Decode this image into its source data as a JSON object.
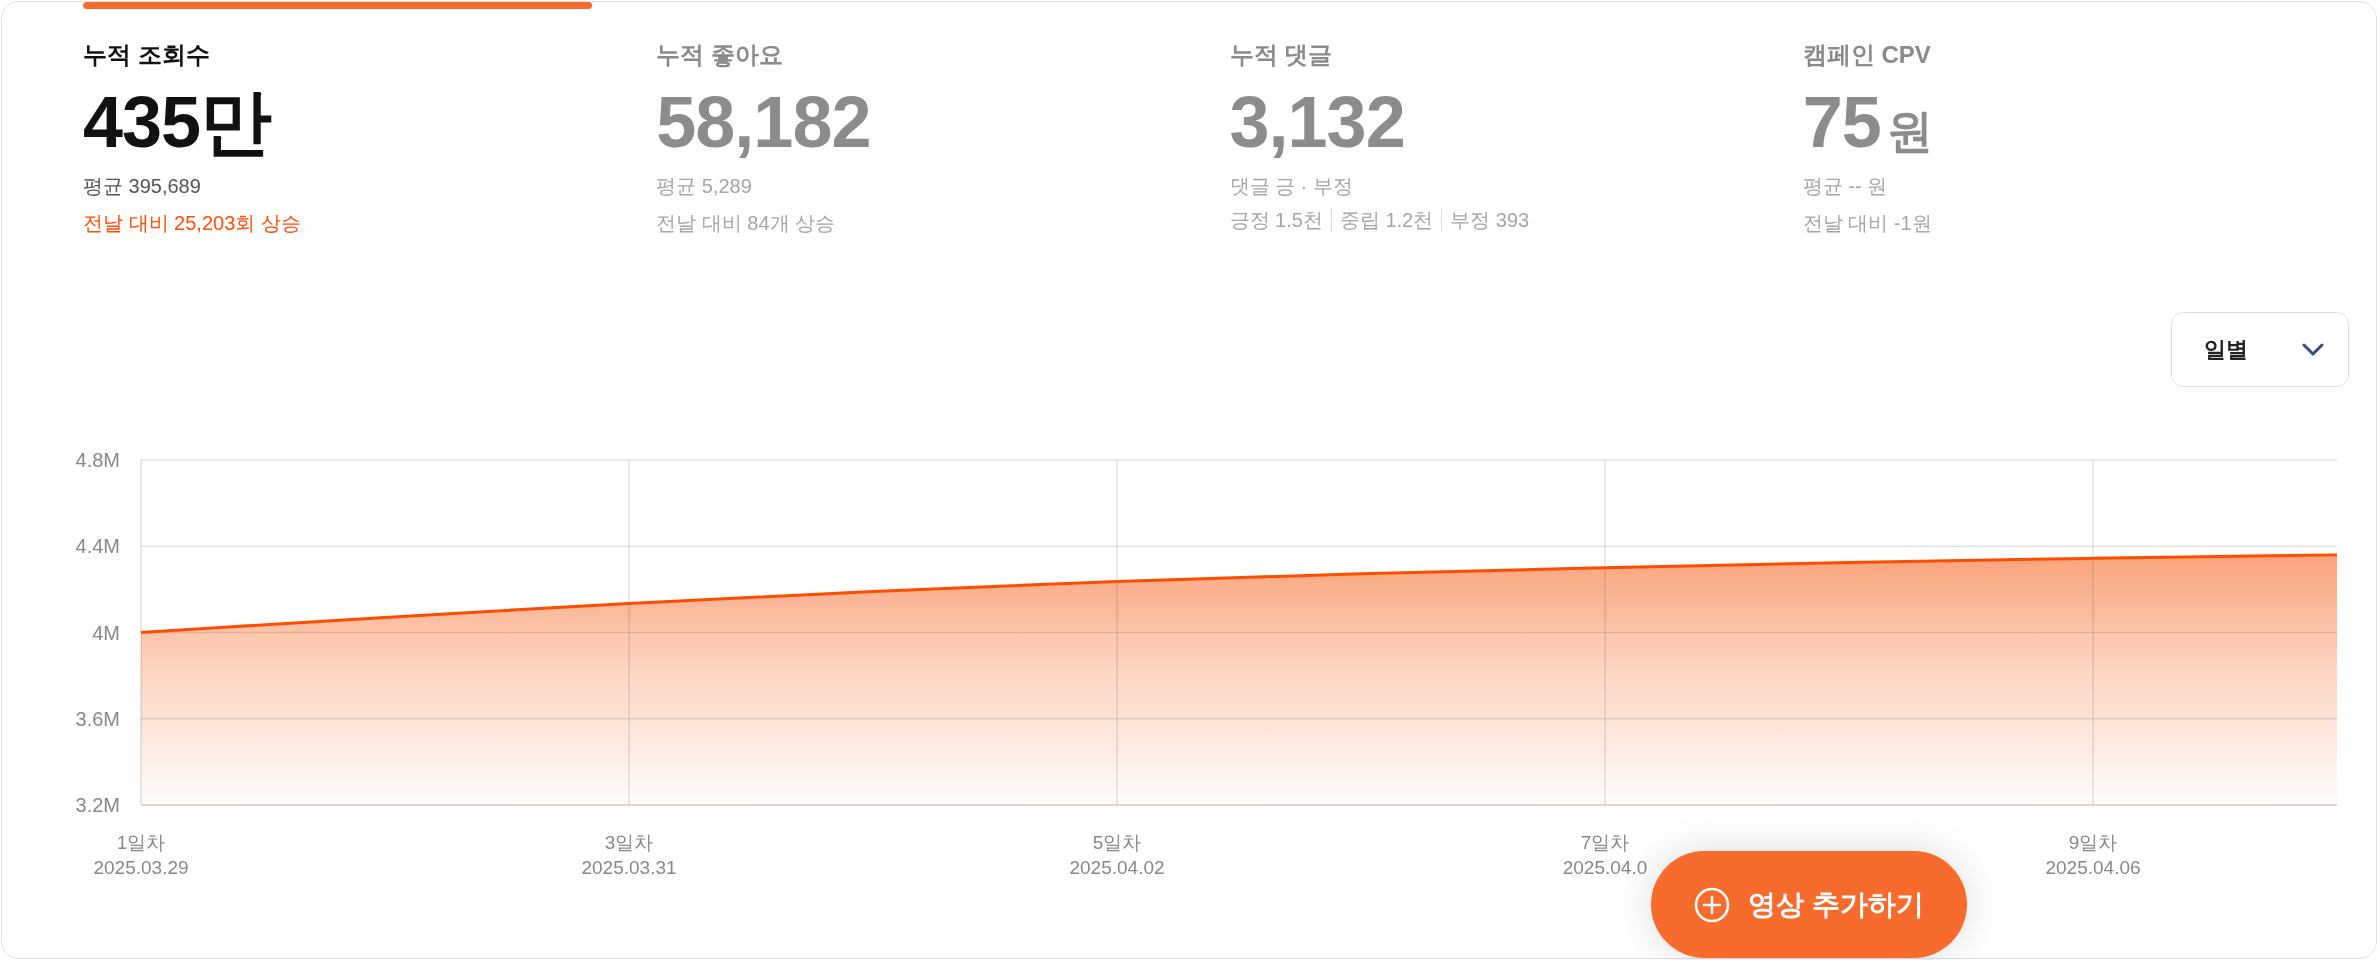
{
  "metrics": [
    {
      "title": "누적 조회수",
      "value": "435만",
      "lines": [
        {
          "kind": "note",
          "text": "평균 395,689"
        },
        {
          "kind": "change",
          "text": "전날 대비 25,203회 상승"
        }
      ],
      "selected": true
    },
    {
      "title": "누적 좋아요",
      "value": "58,182",
      "lines": [
        {
          "kind": "note",
          "text": "평균 5,289"
        },
        {
          "kind": "change",
          "text": "전날 대비 84개 상승"
        }
      ],
      "selected": false
    },
    {
      "title": "누적 댓글",
      "value": "3,132",
      "lines": [
        {
          "kind": "note",
          "text": "댓글 긍 · 부정"
        },
        {
          "kind": "breakdown",
          "parts": [
            "긍정 1.5천",
            "중립 1.2천",
            "부정 393"
          ]
        }
      ],
      "selected": false
    },
    {
      "title": "캠페인 CPV",
      "value": "75",
      "unit": "원",
      "lines": [
        {
          "kind": "note",
          "text": "평균 -- 원"
        },
        {
          "kind": "change",
          "text": "전날 대비 -1원"
        }
      ],
      "selected": false
    }
  ],
  "period_select": {
    "value": "일별"
  },
  "chart": {
    "chart_data": {
      "type": "area",
      "grid": true,
      "categories": [
        "1일차\n2025.03.29",
        null,
        "3일차\n2025.03.31",
        null,
        "5일차\n2025.04.02",
        null,
        "7일차\n2025.04.0",
        null,
        "9일차\n2025.04.06",
        null
      ],
      "values": [
        4000000,
        4070000,
        4135000,
        4190000,
        4237000,
        4272000,
        4300000,
        4325000,
        4344000,
        4360000
      ],
      "ylim": [
        3200000,
        4800000
      ],
      "yticks": [
        {
          "value": 3200000,
          "label": "3.2M"
        },
        {
          "value": 3600000,
          "label": "3.6M"
        },
        {
          "value": 4000000,
          "label": "4M"
        },
        {
          "value": 4400000,
          "label": "4.4M"
        },
        {
          "value": 4800000,
          "label": "4.8M"
        }
      ]
    }
  },
  "add_video_button": {
    "label": "영상 추가하기"
  }
}
